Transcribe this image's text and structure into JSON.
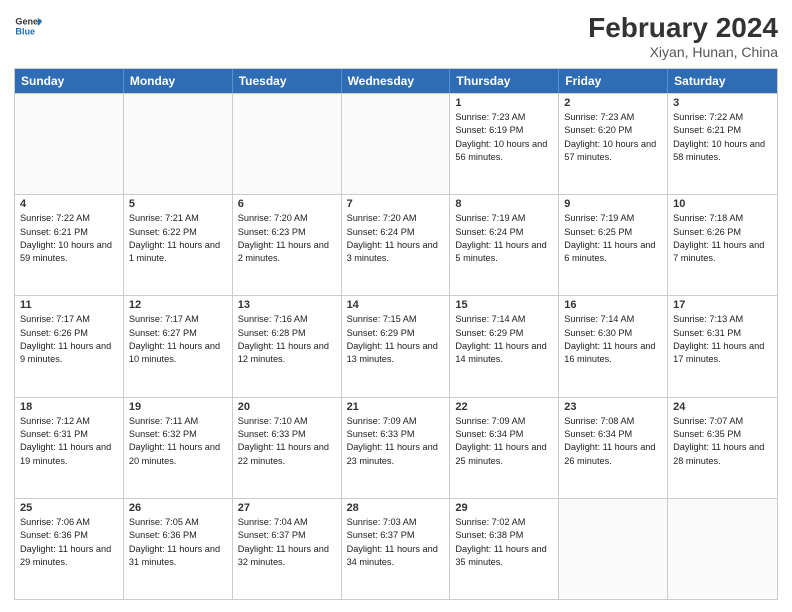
{
  "header": {
    "logo_general": "General",
    "logo_blue": "Blue",
    "month_year": "February 2024",
    "location": "Xiyan, Hunan, China"
  },
  "days_of_week": [
    "Sunday",
    "Monday",
    "Tuesday",
    "Wednesday",
    "Thursday",
    "Friday",
    "Saturday"
  ],
  "weeks": [
    [
      {
        "day": "",
        "sunrise": "",
        "sunset": "",
        "daylight": ""
      },
      {
        "day": "",
        "sunrise": "",
        "sunset": "",
        "daylight": ""
      },
      {
        "day": "",
        "sunrise": "",
        "sunset": "",
        "daylight": ""
      },
      {
        "day": "",
        "sunrise": "",
        "sunset": "",
        "daylight": ""
      },
      {
        "day": "1",
        "sunrise": "Sunrise: 7:23 AM",
        "sunset": "Sunset: 6:19 PM",
        "daylight": "Daylight: 10 hours and 56 minutes."
      },
      {
        "day": "2",
        "sunrise": "Sunrise: 7:23 AM",
        "sunset": "Sunset: 6:20 PM",
        "daylight": "Daylight: 10 hours and 57 minutes."
      },
      {
        "day": "3",
        "sunrise": "Sunrise: 7:22 AM",
        "sunset": "Sunset: 6:21 PM",
        "daylight": "Daylight: 10 hours and 58 minutes."
      }
    ],
    [
      {
        "day": "4",
        "sunrise": "Sunrise: 7:22 AM",
        "sunset": "Sunset: 6:21 PM",
        "daylight": "Daylight: 10 hours and 59 minutes."
      },
      {
        "day": "5",
        "sunrise": "Sunrise: 7:21 AM",
        "sunset": "Sunset: 6:22 PM",
        "daylight": "Daylight: 11 hours and 1 minute."
      },
      {
        "day": "6",
        "sunrise": "Sunrise: 7:20 AM",
        "sunset": "Sunset: 6:23 PM",
        "daylight": "Daylight: 11 hours and 2 minutes."
      },
      {
        "day": "7",
        "sunrise": "Sunrise: 7:20 AM",
        "sunset": "Sunset: 6:24 PM",
        "daylight": "Daylight: 11 hours and 3 minutes."
      },
      {
        "day": "8",
        "sunrise": "Sunrise: 7:19 AM",
        "sunset": "Sunset: 6:24 PM",
        "daylight": "Daylight: 11 hours and 5 minutes."
      },
      {
        "day": "9",
        "sunrise": "Sunrise: 7:19 AM",
        "sunset": "Sunset: 6:25 PM",
        "daylight": "Daylight: 11 hours and 6 minutes."
      },
      {
        "day": "10",
        "sunrise": "Sunrise: 7:18 AM",
        "sunset": "Sunset: 6:26 PM",
        "daylight": "Daylight: 11 hours and 7 minutes."
      }
    ],
    [
      {
        "day": "11",
        "sunrise": "Sunrise: 7:17 AM",
        "sunset": "Sunset: 6:26 PM",
        "daylight": "Daylight: 11 hours and 9 minutes."
      },
      {
        "day": "12",
        "sunrise": "Sunrise: 7:17 AM",
        "sunset": "Sunset: 6:27 PM",
        "daylight": "Daylight: 11 hours and 10 minutes."
      },
      {
        "day": "13",
        "sunrise": "Sunrise: 7:16 AM",
        "sunset": "Sunset: 6:28 PM",
        "daylight": "Daylight: 11 hours and 12 minutes."
      },
      {
        "day": "14",
        "sunrise": "Sunrise: 7:15 AM",
        "sunset": "Sunset: 6:29 PM",
        "daylight": "Daylight: 11 hours and 13 minutes."
      },
      {
        "day": "15",
        "sunrise": "Sunrise: 7:14 AM",
        "sunset": "Sunset: 6:29 PM",
        "daylight": "Daylight: 11 hours and 14 minutes."
      },
      {
        "day": "16",
        "sunrise": "Sunrise: 7:14 AM",
        "sunset": "Sunset: 6:30 PM",
        "daylight": "Daylight: 11 hours and 16 minutes."
      },
      {
        "day": "17",
        "sunrise": "Sunrise: 7:13 AM",
        "sunset": "Sunset: 6:31 PM",
        "daylight": "Daylight: 11 hours and 17 minutes."
      }
    ],
    [
      {
        "day": "18",
        "sunrise": "Sunrise: 7:12 AM",
        "sunset": "Sunset: 6:31 PM",
        "daylight": "Daylight: 11 hours and 19 minutes."
      },
      {
        "day": "19",
        "sunrise": "Sunrise: 7:11 AM",
        "sunset": "Sunset: 6:32 PM",
        "daylight": "Daylight: 11 hours and 20 minutes."
      },
      {
        "day": "20",
        "sunrise": "Sunrise: 7:10 AM",
        "sunset": "Sunset: 6:33 PM",
        "daylight": "Daylight: 11 hours and 22 minutes."
      },
      {
        "day": "21",
        "sunrise": "Sunrise: 7:09 AM",
        "sunset": "Sunset: 6:33 PM",
        "daylight": "Daylight: 11 hours and 23 minutes."
      },
      {
        "day": "22",
        "sunrise": "Sunrise: 7:09 AM",
        "sunset": "Sunset: 6:34 PM",
        "daylight": "Daylight: 11 hours and 25 minutes."
      },
      {
        "day": "23",
        "sunrise": "Sunrise: 7:08 AM",
        "sunset": "Sunset: 6:34 PM",
        "daylight": "Daylight: 11 hours and 26 minutes."
      },
      {
        "day": "24",
        "sunrise": "Sunrise: 7:07 AM",
        "sunset": "Sunset: 6:35 PM",
        "daylight": "Daylight: 11 hours and 28 minutes."
      }
    ],
    [
      {
        "day": "25",
        "sunrise": "Sunrise: 7:06 AM",
        "sunset": "Sunset: 6:36 PM",
        "daylight": "Daylight: 11 hours and 29 minutes."
      },
      {
        "day": "26",
        "sunrise": "Sunrise: 7:05 AM",
        "sunset": "Sunset: 6:36 PM",
        "daylight": "Daylight: 11 hours and 31 minutes."
      },
      {
        "day": "27",
        "sunrise": "Sunrise: 7:04 AM",
        "sunset": "Sunset: 6:37 PM",
        "daylight": "Daylight: 11 hours and 32 minutes."
      },
      {
        "day": "28",
        "sunrise": "Sunrise: 7:03 AM",
        "sunset": "Sunset: 6:37 PM",
        "daylight": "Daylight: 11 hours and 34 minutes."
      },
      {
        "day": "29",
        "sunrise": "Sunrise: 7:02 AM",
        "sunset": "Sunset: 6:38 PM",
        "daylight": "Daylight: 11 hours and 35 minutes."
      },
      {
        "day": "",
        "sunrise": "",
        "sunset": "",
        "daylight": ""
      },
      {
        "day": "",
        "sunrise": "",
        "sunset": "",
        "daylight": ""
      }
    ]
  ]
}
